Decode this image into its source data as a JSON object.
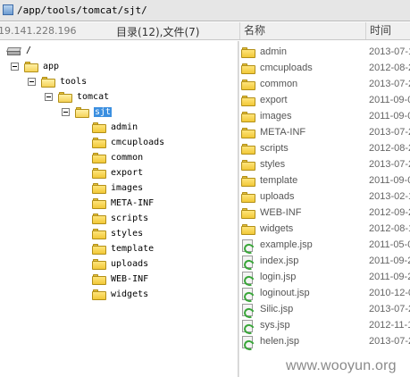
{
  "address_bar": {
    "path": "/app/tools/tomcat/sjt/"
  },
  "status_bar": {
    "ip": "19.141.228.196",
    "summary": "目录(12),文件(7)"
  },
  "columns": {
    "name": "名称",
    "time": "时间"
  },
  "tree": {
    "root": "/",
    "app": "app",
    "tools": "tools",
    "tomcat": "tomcat",
    "selected": "sjt",
    "children": [
      "admin",
      "cmcuploads",
      "common",
      "export",
      "images",
      "META-INF",
      "scripts",
      "styles",
      "template",
      "uploads",
      "WEB-INF",
      "widgets"
    ]
  },
  "files": [
    {
      "name": "admin",
      "time": "2013-07-1",
      "type": "folder"
    },
    {
      "name": "cmcuploads",
      "time": "2012-08-2",
      "type": "folder"
    },
    {
      "name": "common",
      "time": "2013-07-2",
      "type": "folder"
    },
    {
      "name": "export",
      "time": "2011-09-0",
      "type": "folder"
    },
    {
      "name": "images",
      "time": "2011-09-0",
      "type": "folder"
    },
    {
      "name": "META-INF",
      "time": "2013-07-2",
      "type": "folder"
    },
    {
      "name": "scripts",
      "time": "2012-08-2",
      "type": "folder"
    },
    {
      "name": "styles",
      "time": "2013-07-2",
      "type": "folder"
    },
    {
      "name": "template",
      "time": "2011-09-0",
      "type": "folder"
    },
    {
      "name": "uploads",
      "time": "2013-02-1",
      "type": "folder"
    },
    {
      "name": "WEB-INF",
      "time": "2012-09-2",
      "type": "folder"
    },
    {
      "name": "widgets",
      "time": "2012-08-1",
      "type": "folder"
    },
    {
      "name": "example.jsp",
      "time": "2011-05-0",
      "type": "jsp-file"
    },
    {
      "name": "index.jsp",
      "time": "2011-09-2",
      "type": "jsp-file"
    },
    {
      "name": "login.jsp",
      "time": "2011-09-2",
      "type": "jsp-file"
    },
    {
      "name": "loginout.jsp",
      "time": "2010-12-0",
      "type": "jsp-file"
    },
    {
      "name": "Silic.jsp",
      "time": "2013-07-2",
      "type": "jsp-file"
    },
    {
      "name": "sys.jsp",
      "time": "2012-11-1",
      "type": "jsp-file"
    },
    {
      "name": "helen.jsp",
      "time": "2013-07-2",
      "type": "jsp-file"
    }
  ],
  "watermark": "www.wooyun.org"
}
